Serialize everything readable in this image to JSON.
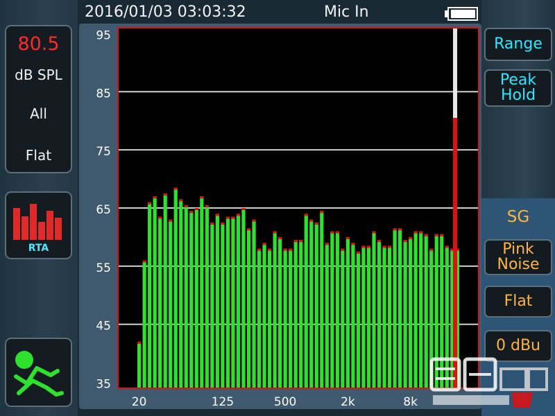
{
  "header": {
    "datetime": "2016/01/03 03:03:32",
    "input": "Mic In",
    "battery_icon": "battery-icon"
  },
  "level_meter": {
    "value": "80.5",
    "unit": "dB SPL",
    "band": "All",
    "weighting": "Flat",
    "value_color": "#ff2a2a"
  },
  "left_nav": {
    "rta_label": "RTA",
    "rta_icon": "rta-bars-icon",
    "run_icon": "running-figure-icon"
  },
  "right_panel": {
    "range_label": "Range",
    "peak_hold_label_1": "Peak",
    "peak_hold_label_2": "Hold",
    "sg_label": "SG",
    "signal_label_1": "Pink",
    "signal_label_2": "Noise",
    "filter_label": "Flat",
    "level_label": "0 dBu"
  },
  "watermark": {
    "brand_icon": "watermark-logo-icon"
  },
  "chart_data": {
    "type": "bar",
    "ylim": [
      34,
      96
    ],
    "yticks": [
      95,
      85,
      75,
      65,
      55,
      45,
      35
    ],
    "xtick_labels": [
      "20",
      "125",
      "500",
      "2k",
      "8k"
    ],
    "xtick_bar_index": [
      0,
      16,
      28,
      40,
      52
    ],
    "values": [
      42,
      56,
      66,
      67,
      63.5,
      67.5,
      63,
      68.5,
      66.5,
      65.5,
      64.5,
      65,
      67,
      65.5,
      62.5,
      64,
      62.5,
      63.5,
      63.5,
      64,
      65,
      61.5,
      63,
      58,
      59,
      58,
      61,
      60,
      58,
      58,
      59.5,
      59.5,
      64,
      63,
      62.5,
      64.5,
      59,
      61,
      61,
      58,
      60,
      59,
      57.5,
      58.5,
      58.5,
      61,
      59.5,
      58.5,
      58.5,
      61.5,
      61.5,
      59.5,
      60,
      61,
      61,
      60.5,
      58,
      60.5,
      60.5,
      58.5,
      58,
      58
    ],
    "overall_level": 80.5,
    "colors": {
      "bar": "#2fe02f",
      "peak_cap": "#e01010",
      "border": "#e01010",
      "grid": "#d0d0d0",
      "background": "#000000"
    }
  }
}
